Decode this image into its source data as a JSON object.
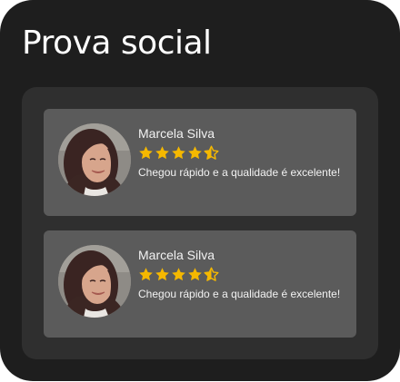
{
  "widget": {
    "title": "Prova social"
  },
  "testimonials": [
    {
      "name": "Marcela Silva",
      "rating": 4.5,
      "rating_max": 5,
      "text": "Chegou rápido e a qualidade é excelente!"
    },
    {
      "name": "Marcela Silva",
      "rating": 4.5,
      "rating_max": 5,
      "text": "Chegou rápido e a qualidade é excelente!"
    }
  ],
  "colors": {
    "background": "#1e1e1e",
    "panel": "#2f2f2f",
    "card": "#5b5b5b",
    "star": "#f5b800",
    "text": "#f2f2f2"
  }
}
